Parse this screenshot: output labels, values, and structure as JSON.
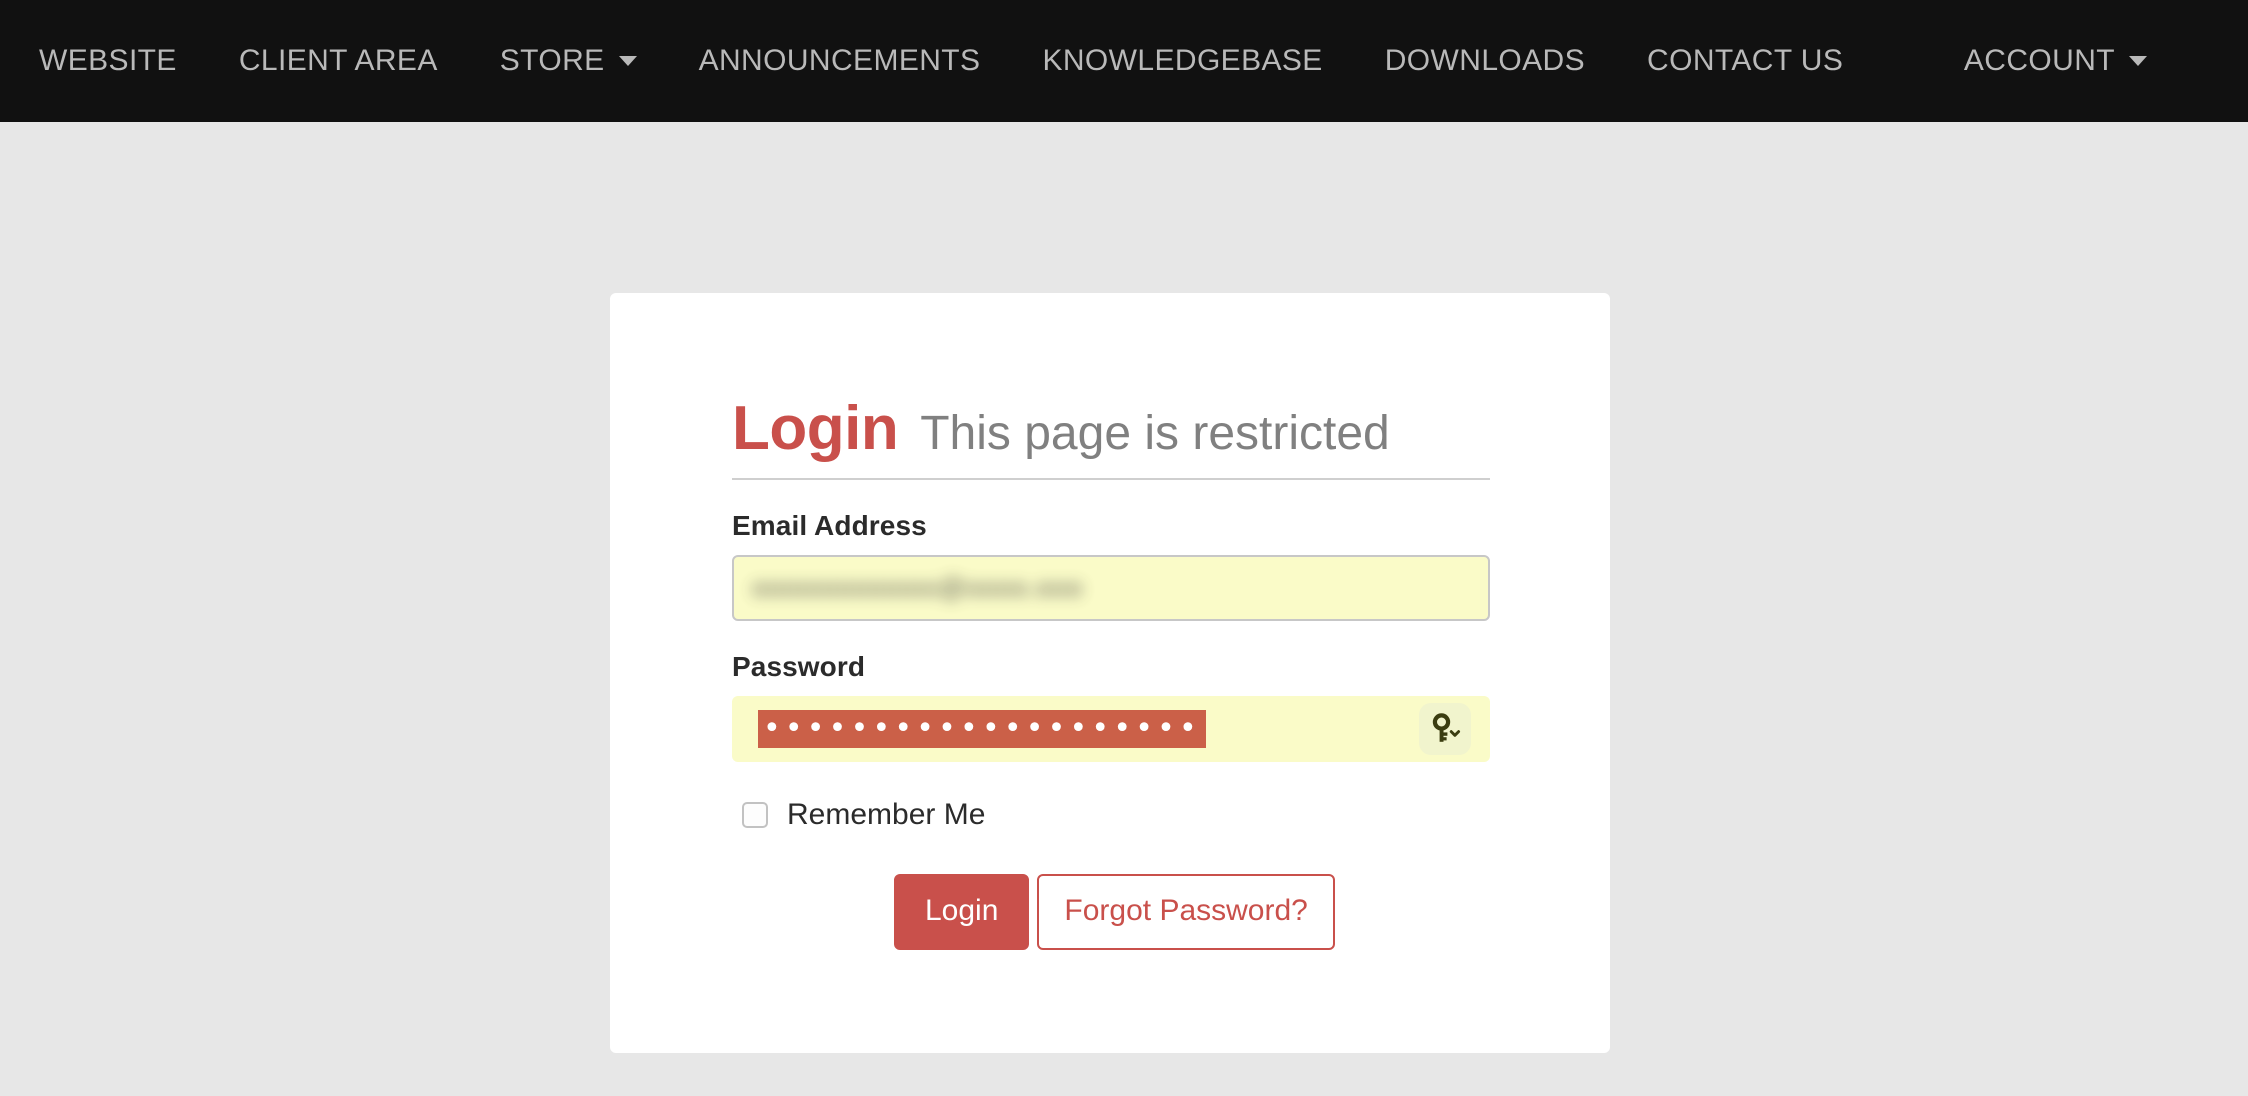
{
  "navbar": {
    "background": "#111111",
    "text_color": "#b9b9b9",
    "left_items": [
      {
        "label": "WEBSITE",
        "has_caret": false
      },
      {
        "label": "CLIENT AREA",
        "has_caret": false
      },
      {
        "label": "STORE",
        "has_caret": true
      },
      {
        "label": "ANNOUNCEMENTS",
        "has_caret": false
      },
      {
        "label": "KNOWLEDGEBASE",
        "has_caret": false
      },
      {
        "label": "DOWNLOADS",
        "has_caret": false
      },
      {
        "label": "CONTACT US",
        "has_caret": false
      }
    ],
    "right_items": [
      {
        "label": "ACCOUNT",
        "has_caret": true
      }
    ]
  },
  "page": {
    "background": "#e7e7e7"
  },
  "card": {
    "background": "#ffffff",
    "heading": {
      "title": "Login",
      "subtitle": "This page is restricted",
      "title_color": "#c9504b",
      "subtitle_color": "#808080"
    },
    "form": {
      "email": {
        "label": "Email Address",
        "value": "oooooooooooo@oooo.ooo",
        "placeholder": "Email Address",
        "autofilled": true,
        "autofill_background": "#fafbc8",
        "redacted": true
      },
      "password": {
        "label": "Password",
        "value": "••••••••••••••••••••",
        "placeholder": "Password",
        "autofilled": true,
        "autofill_background": "#fafbc8",
        "selected": true,
        "selection_color": "#cb6048",
        "manager_icon": "key-icon",
        "manager_caret": "chevron-down-icon"
      },
      "remember": {
        "label": "Remember Me",
        "checked": false
      },
      "buttons": {
        "submit": "Login",
        "forgot": "Forgot Password?",
        "accent": "#c9504b"
      }
    }
  }
}
